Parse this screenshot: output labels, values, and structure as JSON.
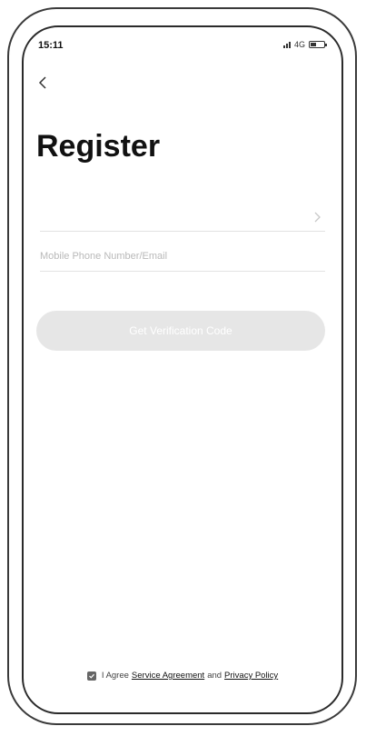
{
  "status_bar": {
    "time": "15:11",
    "network": "4G"
  },
  "header": {
    "title": "Register"
  },
  "form": {
    "region_value": "",
    "account_placeholder": "Mobile Phone Number/Email",
    "account_value": "",
    "verify_button_label": "Get Verification Code"
  },
  "agreement": {
    "prefix": "I Agree",
    "service_link": "Service Agreement",
    "conjunction": "and",
    "privacy_link": "Privacy Policy"
  },
  "colors": {
    "button_disabled": "#e6e6e6",
    "divider": "#e2e2e2"
  }
}
